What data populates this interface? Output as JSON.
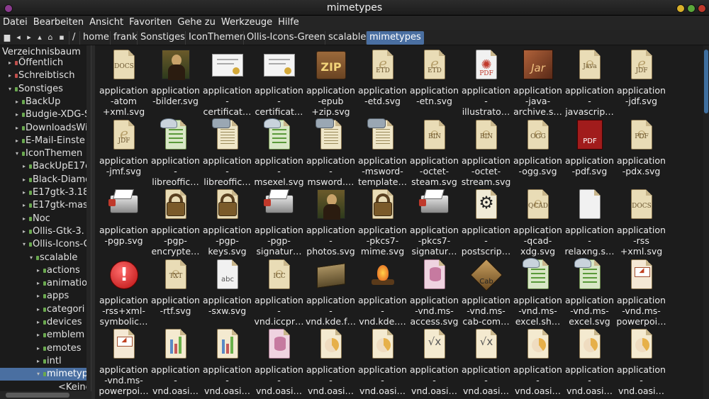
{
  "window": {
    "title": "mimetypes"
  },
  "menu": [
    "Datei",
    "Bearbeiten",
    "Ansicht",
    "Favoriten",
    "Gehe zu",
    "Werkzeuge",
    "Hilfe"
  ],
  "breadcrumb": [
    "/",
    "home",
    "frank",
    "Sonstiges",
    "IconThemen",
    "Ollis-Icons-Green",
    "scalable",
    "mimetypes"
  ],
  "sidebar": {
    "header": "Verzeichnisbaum",
    "items": [
      {
        "label": "Öffentlich",
        "level": 1,
        "expanded": false,
        "color": "red"
      },
      {
        "label": "Schreibtisch",
        "level": 1,
        "expanded": false,
        "color": "red"
      },
      {
        "label": "Sonstiges",
        "level": 1,
        "expanded": true,
        "color": "green"
      },
      {
        "label": "BackUp",
        "level": 2,
        "expanded": false,
        "color": "green"
      },
      {
        "label": "Budgie-XDG-S",
        "level": 2,
        "expanded": false,
        "color": "green"
      },
      {
        "label": "DownloadsWi",
        "level": 2,
        "expanded": false,
        "color": "green"
      },
      {
        "label": "E-Mail-Einste",
        "level": 2,
        "expanded": false,
        "color": "green"
      },
      {
        "label": "IconThemen",
        "level": 2,
        "expanded": true,
        "color": "green"
      },
      {
        "label": "BackUpE17c",
        "level": 3,
        "expanded": false,
        "color": "green"
      },
      {
        "label": "Black-Diamo",
        "level": 3,
        "expanded": false,
        "color": "green"
      },
      {
        "label": "E17gtk-3.18",
        "level": 3,
        "expanded": false,
        "color": "green"
      },
      {
        "label": "E17gtk-mas",
        "level": 3,
        "expanded": false,
        "color": "green"
      },
      {
        "label": "Noc",
        "level": 3,
        "expanded": false,
        "color": "green"
      },
      {
        "label": "Ollis-Gtk-3.",
        "level": 3,
        "expanded": false,
        "color": "green"
      },
      {
        "label": "Ollis-Icons-G",
        "level": 3,
        "expanded": true,
        "color": "green"
      },
      {
        "label": "scalable",
        "level": 4,
        "expanded": true,
        "color": "green"
      },
      {
        "label": "actions",
        "level": 5,
        "expanded": false,
        "color": "green"
      },
      {
        "label": "animatio",
        "level": 5,
        "expanded": false,
        "color": "green"
      },
      {
        "label": "apps",
        "level": 5,
        "expanded": false,
        "color": "green"
      },
      {
        "label": "categori",
        "level": 5,
        "expanded": false,
        "color": "green"
      },
      {
        "label": "devices",
        "level": 5,
        "expanded": false,
        "color": "green"
      },
      {
        "label": "emblem",
        "level": 5,
        "expanded": false,
        "color": "green"
      },
      {
        "label": "emotes",
        "level": 5,
        "expanded": false,
        "color": "green"
      },
      {
        "label": "intl",
        "level": 5,
        "expanded": false,
        "color": "green"
      },
      {
        "label": "mimetyp",
        "level": 5,
        "expanded": true,
        "color": "green",
        "selected": true
      },
      {
        "label": "<Keine",
        "level": 6,
        "expanded": false,
        "color": "none"
      }
    ]
  },
  "files": [
    {
      "name": "application\n-atom\n+xml.svg",
      "icon": "doc-icon",
      "kind": "doc",
      "tag": "DOCS"
    },
    {
      "name": "application\n-bilder.svg",
      "icon": "mona-lisa-icon",
      "kind": "mona"
    },
    {
      "name": "application\n-\ncertificat…",
      "icon": "certificate-icon",
      "kind": "cert"
    },
    {
      "name": "application\n-\ncertificat…",
      "icon": "certificate-icon",
      "kind": "cert"
    },
    {
      "name": "application\n-epub\n+zip.svg",
      "icon": "zip-box-icon",
      "kind": "zip",
      "tag": "ZIP"
    },
    {
      "name": "application\n-etd.svg",
      "icon": "etd-doc-icon",
      "kind": "e",
      "tag": "ETD"
    },
    {
      "name": "application\n-etn.svg",
      "icon": "etd-doc-icon",
      "kind": "e",
      "tag": "ETD"
    },
    {
      "name": "application\n-\nillustrato…",
      "icon": "pdf-white-icon",
      "kind": "pdfw",
      "tag": "PDF"
    },
    {
      "name": "application\n-java-\narchive.s…",
      "icon": "jar-box-icon",
      "kind": "jar",
      "tag": "Jar"
    },
    {
      "name": "application\n-\njavascrip…",
      "icon": "java-doc-icon",
      "kind": "doc",
      "tag": "Java"
    },
    {
      "name": "application\n-jdf.svg",
      "icon": "jdf-doc-icon",
      "kind": "e",
      "tag": "JDF"
    },
    {
      "name": "application\n-jmf.svg",
      "icon": "jdf-doc-icon",
      "kind": "e",
      "tag": "JDF"
    },
    {
      "name": "application\n-\nlibreoffic…",
      "icon": "spreadsheet-icon",
      "kind": "green"
    },
    {
      "name": "application\n-\nlibreoffic…",
      "icon": "typewriter-doc-icon",
      "kind": "type"
    },
    {
      "name": "application\n-\nmsexel.svg",
      "icon": "spreadsheet-icon",
      "kind": "green"
    },
    {
      "name": "application\n-\nmsword.…",
      "icon": "typewriter-doc-icon",
      "kind": "type"
    },
    {
      "name": "application\n-msword-\ntemplate…",
      "icon": "typewriter-doc-icon",
      "kind": "type"
    },
    {
      "name": "application\n-octet-\nsteam.svg",
      "icon": "bin-doc-icon",
      "kind": "doc",
      "tag": "BIN"
    },
    {
      "name": "application\n-octet-\nstream.svg",
      "icon": "bin-doc-icon",
      "kind": "doc",
      "tag": "BIN"
    },
    {
      "name": "application\n-ogg.svg",
      "icon": "ogg-doc-icon",
      "kind": "doc",
      "tag": "OGG"
    },
    {
      "name": "application\n-pdf.svg",
      "icon": "pdf-book-icon",
      "kind": "pdfbook",
      "tag": "PDF"
    },
    {
      "name": "application\n-pdx.svg",
      "icon": "pdf-doc-icon",
      "kind": "doc",
      "tag": "PDF"
    },
    {
      "name": "application\n-pgp.svg",
      "icon": "printer-icon",
      "kind": "printer"
    },
    {
      "name": "application\n-pgp-\nencrypte…",
      "icon": "padlock-icon",
      "kind": "lock"
    },
    {
      "name": "application\n-pgp-\nkeys.svg",
      "icon": "padlock-icon",
      "kind": "lock"
    },
    {
      "name": "application\n-pgp-\nsignatur…",
      "icon": "printer-icon",
      "kind": "printer"
    },
    {
      "name": "application\n-\nphotos.svg",
      "icon": "mona-lisa-icon",
      "kind": "mona"
    },
    {
      "name": "application\n-pkcs7-\nmime.svg",
      "icon": "padlock-icon",
      "kind": "lock"
    },
    {
      "name": "application\n-pkcs7-\nsignatur…",
      "icon": "printer-icon",
      "kind": "printer"
    },
    {
      "name": "application\n-\npostscrip…",
      "icon": "gear-doc-icon",
      "kind": "gear"
    },
    {
      "name": "application\n-qcad-\nxdg.svg",
      "icon": "qcad-doc-icon",
      "kind": "doc",
      "tag": "QCAD"
    },
    {
      "name": "application\n-\nrelaxng.s…",
      "icon": "white-doc-icon",
      "kind": "white"
    },
    {
      "name": "application\n-rss\n+xml.svg",
      "icon": "doc-icon",
      "kind": "doc",
      "tag": "DOCS"
    },
    {
      "name": "application\n-rss+xml-\nsymbolic…",
      "icon": "error-icon",
      "kind": "error"
    },
    {
      "name": "application\n-rtf.svg",
      "icon": "txt-doc-icon",
      "kind": "doc",
      "tag": "TXT"
    },
    {
      "name": "application\n-sxw.svg",
      "icon": "abc-doc-icon",
      "kind": "white",
      "tag": "abc"
    },
    {
      "name": "application\n-\nvnd.iccpr…",
      "icon": "icc-doc-icon",
      "kind": "doc",
      "tag": "ICC"
    },
    {
      "name": "application\n-\nvnd.kde.f…",
      "icon": "archive-box-icon",
      "kind": "box"
    },
    {
      "name": "application\n-\nvnd.kde.…",
      "icon": "campfire-icon",
      "kind": "fire"
    },
    {
      "name": "application\n-vnd.ms-\naccess.svg",
      "icon": "database-doc-icon",
      "kind": "pink"
    },
    {
      "name": "application\n-vnd.ms-\ncab-com…",
      "icon": "cab-box-icon",
      "kind": "cab",
      "tag": "Cab"
    },
    {
      "name": "application\n-vnd.ms-\nexcel.sh…",
      "icon": "spreadsheet-icon",
      "kind": "green"
    },
    {
      "name": "application\n-vnd.ms-\nexcel.svg",
      "icon": "spreadsheet-icon",
      "kind": "green"
    },
    {
      "name": "application\n-vnd.ms-\npowerpoi…",
      "icon": "presentation-doc-icon",
      "kind": "pres"
    },
    {
      "name": "application\n-vnd.ms-\npowerpoi…",
      "icon": "presentation-doc-icon",
      "kind": "pres"
    },
    {
      "name": "application\n-\nvnd.oasi…",
      "icon": "chart-doc-icon",
      "kind": "chart"
    },
    {
      "name": "application\n-\nvnd.oasi…",
      "icon": "chart-doc-icon",
      "kind": "chart"
    },
    {
      "name": "application\n-\nvnd.oasi…",
      "icon": "database-doc-icon",
      "kind": "pink"
    },
    {
      "name": "application\n-\nvnd.oasi…",
      "icon": "pie-doc-icon",
      "kind": "pie"
    },
    {
      "name": "application\n-\nvnd.oasi…",
      "icon": "pie-doc-icon",
      "kind": "pie"
    },
    {
      "name": "application\n-\nvnd.oasi…",
      "icon": "formula-doc-icon",
      "kind": "formula"
    },
    {
      "name": "application\n-\nvnd.oasi…",
      "icon": "formula-doc-icon",
      "kind": "formula"
    },
    {
      "name": "application\n-\nvnd.oasi…",
      "icon": "pie-doc-icon",
      "kind": "pie"
    },
    {
      "name": "application\n-\nvnd.oasi…",
      "icon": "pie-doc-icon",
      "kind": "pie"
    },
    {
      "name": "application\n-\nvnd.oasi…",
      "icon": "pie-doc-icon",
      "kind": "pie"
    }
  ],
  "colors": {
    "selection": "#4a6fa1",
    "background": "#1c1c1c",
    "text": "#ececec"
  }
}
